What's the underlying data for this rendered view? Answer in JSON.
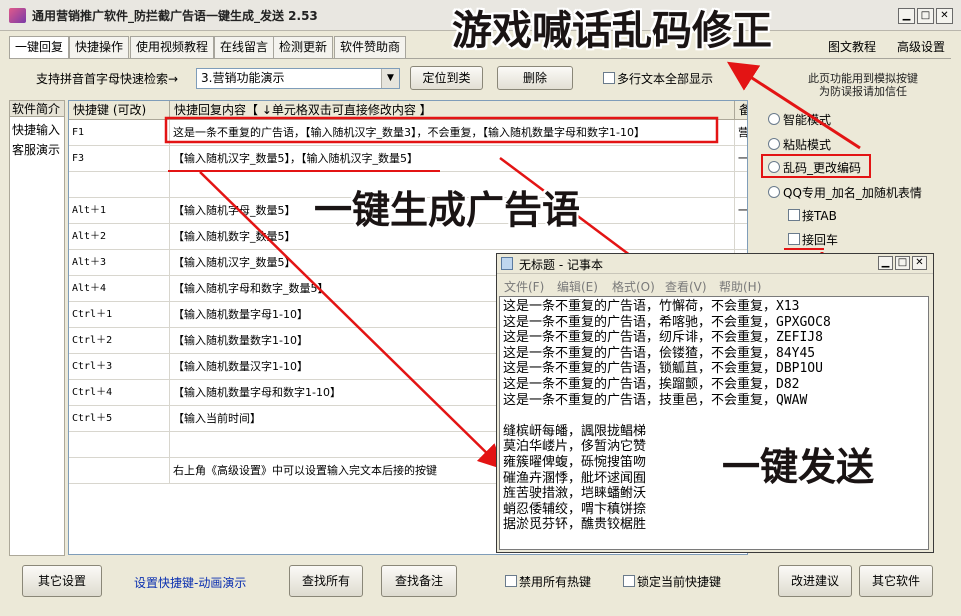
{
  "window": {
    "title": "通用营销推广软件_防拦截广告语一键生成_发送 2.53",
    "min_icon": "minimize-icon",
    "max_icon": "maximize-icon",
    "close_icon": "close-icon"
  },
  "menu": {
    "tabs": [
      "一键回复",
      "快捷操作",
      "使用视频教程",
      "在线留言",
      "检测更新",
      "软件赞助商"
    ],
    "right": [
      "图文教程",
      "高级设置"
    ]
  },
  "toolbar": {
    "search_label": "支持拼音首字母快速检索→",
    "search_value": "3.营销功能演示",
    "locate_button": "定位到类",
    "delete_button": "删除",
    "multiline_label": "多行文本全部显示"
  },
  "left_panel": {
    "header": "软件简介",
    "items": [
      "快捷输入",
      "客服演示"
    ]
  },
  "grid": {
    "headers": [
      "快捷键 (可改)",
      "快捷回复内容【 ↓单元格双击可直接修改内容 】",
      "备"
    ],
    "rows": [
      {
        "key": "F1",
        "content": "这是一条不重复的广告语，【输入随机汉字_数量3】，不会重复，【输入随机数量字母和数字1-10】",
        "note": "营"
      },
      {
        "key": "F3",
        "content": "【输入随机汉字_数量5】，【输入随机汉字_数量5】",
        "note": "一"
      },
      {
        "key": "",
        "content": "",
        "note": ""
      },
      {
        "key": "Alt＋1",
        "content": "【输入随机字母_数量5】",
        "note": "一"
      },
      {
        "key": "Alt＋2",
        "content": "【输入随机数字_数量5】",
        "note": ""
      },
      {
        "key": "Alt＋3",
        "content": "【输入随机汉字_数量5】",
        "note": ""
      },
      {
        "key": "Alt＋4",
        "content": "【输入随机字母和数字_数量5】",
        "note": ""
      },
      {
        "key": "Ctrl＋1",
        "content": "【输入随机数量字母1-10】",
        "note": ""
      },
      {
        "key": "Ctrl＋2",
        "content": "【输入随机数量数字1-10】",
        "note": ""
      },
      {
        "key": "Ctrl＋3",
        "content": "【输入随机数量汉字1-10】",
        "note": ""
      },
      {
        "key": "Ctrl＋4",
        "content": "【输入随机数量字母和数字1-10】",
        "note": ""
      },
      {
        "key": "Ctrl＋5",
        "content": "【输入当前时间】",
        "note": ""
      },
      {
        "key": "",
        "content": "",
        "note": ""
      },
      {
        "key": "",
        "content": "右上角《高级设置》中可以设置输入完文本后接的按键",
        "note": ""
      }
    ]
  },
  "right_panel": {
    "info": "此页功能用到模拟按键\n为防误报请加信任",
    "options": [
      "智能模式",
      "粘贴模式",
      "乱码_更改编码",
      "QQ专用_加名_加随机表情"
    ],
    "checks": [
      "接TAB",
      "接回车"
    ]
  },
  "notepad": {
    "title": "无标题 - 记事本",
    "menu": [
      "文件(F)",
      "编辑(E)",
      "格式(O)",
      "查看(V)",
      "帮助(H)"
    ],
    "text": "这是一条不重复的广告语，竹懈荷，不会重复，X13\n这是一条不重复的广告语，希喀驰，不会重复，GPXGOC8\n这是一条不重复的广告语，纫斥诽，不会重复，ZEFIJ8\n这是一条不重复的广告语，侩镂猹，不会重复，84Y45\n这是一条不重复的广告语，锁觚苴，不会重复，DBP1OU\n这是一条不重复的广告语，挨蹓颤，不会重复，D82\n这是一条不重复的广告语，技重邑，不会重复，QWAW\n\n缝槟岍每皤，諷限拢鲳梯\n莫泊华嵝片，侈暂汭它赞\n雍簇曜俾蝮，砾惋搜笛吻\n磪渔卉溷悸，舭坏逑闻囿\n旌苦驶措漵，垲睐蟠鲋沃\n蛸忍倭辅绞，喟卞稹饼捺\n据淤觅芬钚，醮贵铰椐胜"
  },
  "captions": {
    "fix_garble": "游戏喊话乱码修正",
    "generate": "一键生成广告语",
    "send": "一键发送"
  },
  "bottom": {
    "other_settings": "其它设置",
    "hotkey_link": "设置快捷键-动画演示",
    "find_all": "查找所有",
    "find_note": "查找备注",
    "disable_hotkeys": "禁用所有热键",
    "lock_hotkey": "锁定当前快捷键",
    "suggest": "改进建议",
    "other_software": "其它软件"
  },
  "colors": {
    "annotation_red": "#e31414",
    "window_bg": "#ece9d8"
  }
}
